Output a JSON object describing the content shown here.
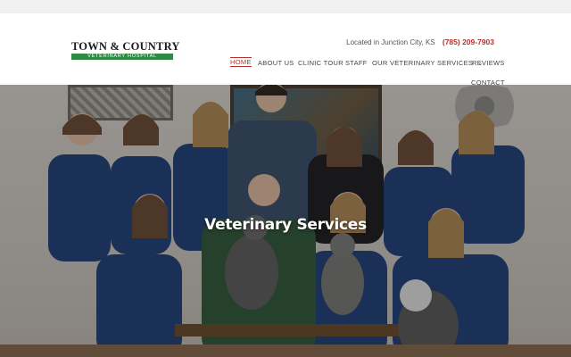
{
  "brand": {
    "name": "TOWN & COUNTRY",
    "tagline": "VETERINARY HOSPITAL",
    "accent_color": "#b4322b",
    "logo_green": "#2e8b45"
  },
  "topbar": {
    "location_text": "Located in Junction City, KS",
    "phone": "(785) 209-7903"
  },
  "nav": {
    "items": [
      {
        "label": "HOME",
        "active": true
      },
      {
        "label": "ABOUT US",
        "active": false
      },
      {
        "label": "CLINIC TOUR",
        "active": false
      },
      {
        "label": "STAFF",
        "active": false
      },
      {
        "label": "OUR VETERINARY SERVICES",
        "active": false,
        "dropdown_icon": "chevron-down-icon"
      },
      {
        "label": "REVIEWS",
        "active": false
      },
      {
        "label": "CONTACT",
        "active": false
      }
    ]
  },
  "hero": {
    "title": "Veterinary Services",
    "image_subject": "team-photo"
  }
}
